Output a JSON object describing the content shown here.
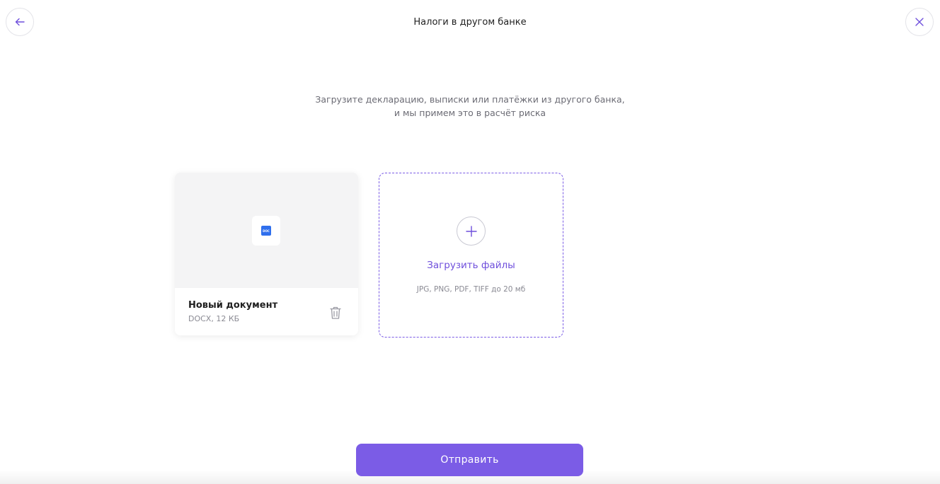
{
  "header": {
    "title": "Налоги в другом банке",
    "back_icon": "arrow-left-icon",
    "close_icon": "close-icon"
  },
  "intro": {
    "line1": "Загрузите декларацию, выписки или платёжки из другого банка,",
    "line2": "и мы примем это в расчёт риска"
  },
  "files": [
    {
      "name": "Новый документ",
      "meta": "DOCX, 12 КБ",
      "icon": "doc-file-icon",
      "icon_text": "DOC"
    }
  ],
  "upload": {
    "label": "Загрузить файлы",
    "hint": "JPG, PNG, PDF, TIFF до 20 мб",
    "icon": "plus-icon"
  },
  "footer": {
    "submit_label": "Отправить"
  },
  "colors": {
    "accent": "#7b5ce6",
    "accent_text": "#6f4fdc",
    "doc_icon": "#2f6fed"
  }
}
